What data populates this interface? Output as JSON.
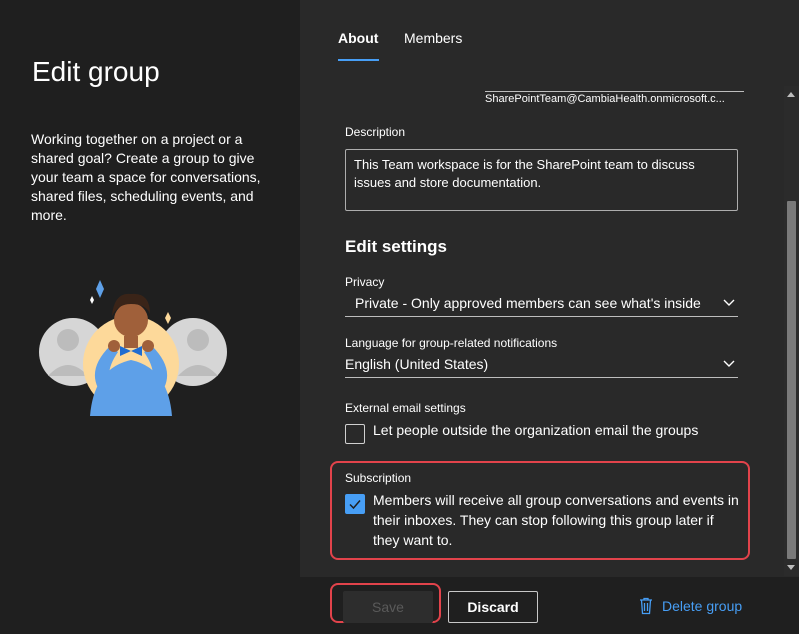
{
  "left": {
    "title": "Edit group",
    "intro": "Working together on a project or a shared goal? Create a group to give your team a space for conversations, shared files, scheduling events, and more."
  },
  "tabs": [
    {
      "label": "About",
      "selected": true
    },
    {
      "label": "Members",
      "selected": false
    }
  ],
  "group_email": "SharePointTeam@CambiaHealth.onmicrosoft.c...",
  "description": {
    "label": "Description",
    "value": "This Team workspace is for the SharePoint team to discuss issues and store documentation."
  },
  "settings": {
    "heading": "Edit settings",
    "privacy": {
      "label": "Privacy",
      "value": "Private - Only approved members can see what's inside"
    },
    "language": {
      "label": "Language for group-related notifications",
      "value": "English (United States)"
    },
    "external": {
      "label": "External email settings",
      "checkbox_label": "Let people outside the organization email the groups",
      "checked": false
    },
    "subscription": {
      "label": "Subscription",
      "checkbox_label": "Members will receive all group conversations and events in their inboxes. They can stop following this group later if they want to.",
      "checked": true
    }
  },
  "footer": {
    "save_label": "Save",
    "discard_label": "Discard",
    "delete_label": "Delete group"
  },
  "colors": {
    "accent": "#479ef5",
    "highlight": "#e2434b",
    "panel_left": "#1f1f1f",
    "panel_right": "#292929"
  }
}
